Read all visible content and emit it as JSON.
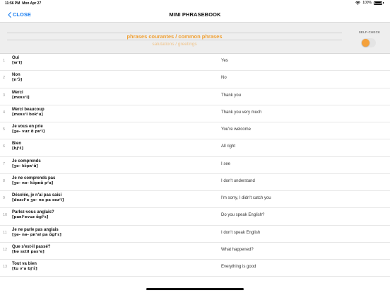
{
  "status_bar": {
    "time": "11:56 PM",
    "date": "Mon Apr 27",
    "battery": "100%",
    "battery_level": 1.0,
    "icons": [
      "wifi-icon",
      "battery-icon"
    ]
  },
  "nav": {
    "close_label": "CLOSE",
    "title": "MINI PHRASEBOOK",
    "accent_color": "#1a7ef0"
  },
  "header": {
    "category": "phrases courantes / common phrases",
    "subcategory": "salutations / greetings",
    "self_check_label": "SELF-CHECK",
    "self_check_on": false,
    "accent_color": "#f0a033"
  },
  "phrases": [
    {
      "num": "1",
      "phrase": "Oui",
      "ipa": "[wʼi]",
      "translation": "Yes"
    },
    {
      "num": "2",
      "phrase": "Non",
      "ipa": "[nʼɔ̃]",
      "translation": "No"
    },
    {
      "num": "3",
      "phrase": "Merci",
      "ipa": "[mɛʀsʼi]",
      "translation": "Thank you"
    },
    {
      "num": "4",
      "phrase": "Merci beaucoup",
      "ipa": "[mɛʀsʼi bokʼu]",
      "translation": "Thank you very much"
    },
    {
      "num": "5",
      "phrase": "Je vous en prie",
      "ipa": "[ʒə- vuz ɑ̃ pʀʼi]",
      "translation": "You're welcome"
    },
    {
      "num": "6",
      "phrase": "Bien",
      "ipa": "[bjʼɛ̃]",
      "translation": "All right"
    },
    {
      "num": "7",
      "phrase": "Je comprends",
      "ipa": "[ʒə- kɔ̃pʀʼɑ̃]",
      "translation": "I see"
    },
    {
      "num": "8",
      "phrase": "Je ne comprends pas",
      "ipa": "[ʒə- nə- kɔ̃pʀɑ̃ pʼa]",
      "translation": "I don't understand"
    },
    {
      "num": "9",
      "phrase": "Désolée, je n'ai pas saisi",
      "ipa": "[dezɔlʼe ʒə- ne pa sezʼi]",
      "translation": "I'm sorry, I didn't catch you"
    },
    {
      "num": "10",
      "phrase": "Parlez-vous anglais?",
      "ipa": "[paʀlʼevuz ɑ̃glʼɛ]",
      "translation": "Do you speak English?"
    },
    {
      "num": "11",
      "phrase": "Je ne parle pas anglais",
      "ipa": "[ʒə- nə- pʀʼal pa ɑ̃glʼɛ]",
      "translation": "I don't speak English"
    },
    {
      "num": "12",
      "phrase": "Que s'est-il passé?",
      "ipa": "[kə sɛtil pasʼe]",
      "translation": "What happened?"
    },
    {
      "num": "13",
      "phrase": "Tout va bien",
      "ipa": "[tu vʼa bjʼɛ̃]",
      "translation": "Everything is good"
    }
  ]
}
